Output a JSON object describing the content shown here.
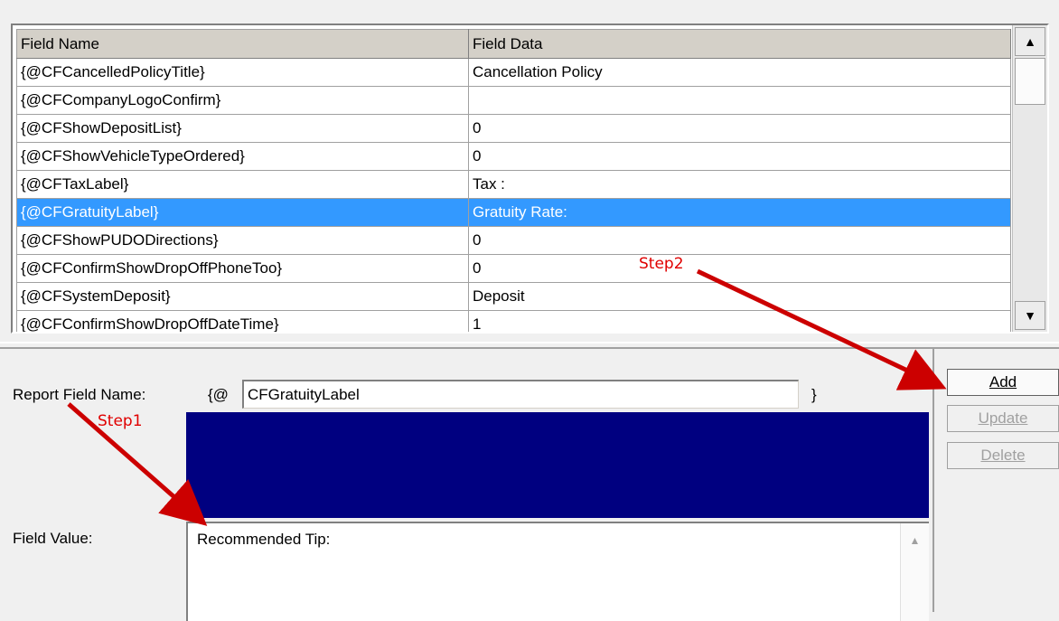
{
  "grid": {
    "headers": [
      "Field Name",
      "Field Data"
    ],
    "rows": [
      {
        "name": "{@CFCancelledPolicyTitle}",
        "data": "Cancellation Policy"
      },
      {
        "name": "{@CFCompanyLogoConfirm}",
        "data": ""
      },
      {
        "name": "{@CFShowDepositList}",
        "data": "0"
      },
      {
        "name": "{@CFShowVehicleTypeOrdered}",
        "data": "0"
      },
      {
        "name": "{@CFTaxLabel}",
        "data": "Tax :"
      },
      {
        "name": "{@CFGratuityLabel}",
        "data": "Gratuity Rate:"
      },
      {
        "name": "{@CFShowPUDODirections}",
        "data": "0"
      },
      {
        "name": "{@CFConfirmShowDropOffPhoneToo}",
        "data": "0"
      },
      {
        "name": "{@CFSystemDeposit}",
        "data": "Deposit"
      },
      {
        "name": "{@CFConfirmShowDropOffDateTime}",
        "data": "1"
      }
    ],
    "selected_index": 5
  },
  "form": {
    "report_field_label": "Report Field Name:",
    "prefix": "{@",
    "field_name_value": "CFGratuityLabel",
    "suffix": "}",
    "field_value_label": "Field Value:",
    "field_value_text": "Recommended Tip:"
  },
  "buttons": {
    "add": "Add",
    "update": "Update",
    "delete": "Delete"
  },
  "annotations": {
    "step1": "Step1",
    "step2": "Step2",
    "color": "#cc0000"
  },
  "colors": {
    "selection": "#3399ff",
    "navy_box": "#000080"
  },
  "icons": {
    "scroll_up": "▲",
    "scroll_down": "▼"
  }
}
